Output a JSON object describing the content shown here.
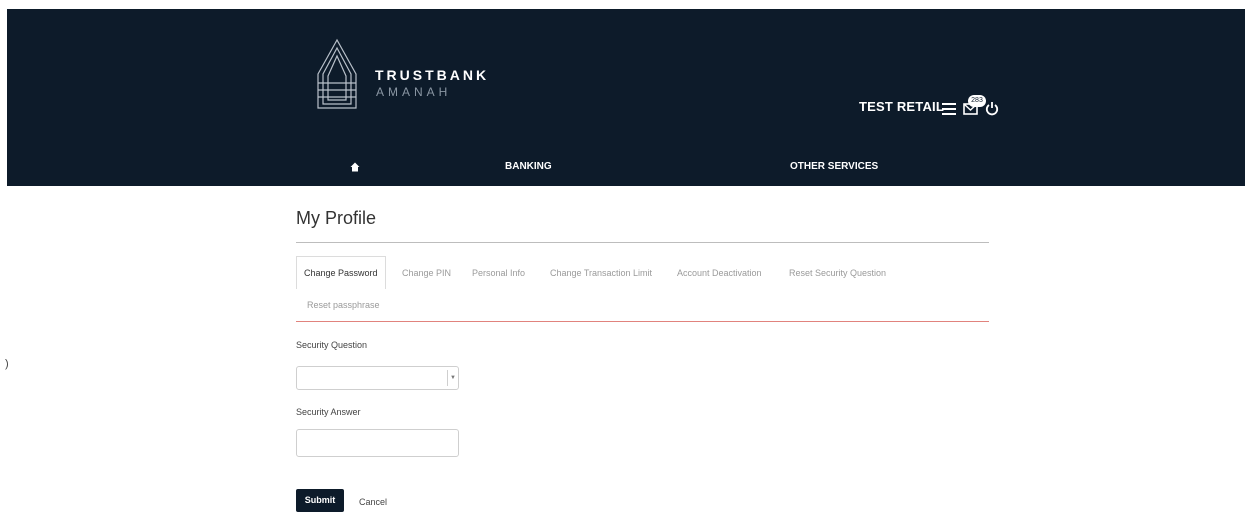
{
  "header": {
    "logo": {
      "name": "TRUSTBANK",
      "sub": "AMANAH"
    },
    "user_name": "TEST RETAIL",
    "mail_badge": "283",
    "icons": [
      "hamburger-menu-icon",
      "mail-icon",
      "power-icon"
    ]
  },
  "nav": {
    "home_icon": "home-icon",
    "banking": "BANKING",
    "other_services": "OTHER SERVICES"
  },
  "page": {
    "title": "My Profile",
    "tabs": [
      "Change Password",
      "Change PIN",
      "Personal Info",
      "Change Transaction Limit",
      "Account Deactivation",
      "Reset Security Question",
      "Reset passphrase"
    ],
    "active_tab": "Change Password"
  },
  "form": {
    "security_question_label": "Security Question",
    "security_question_value": "",
    "security_answer_label": "Security Answer",
    "security_answer_value": "",
    "submit_label": "Submit",
    "cancel_label": "Cancel"
  },
  "edge_mark": ")",
  "colors": {
    "header_bg": "#0d1b2a",
    "tab_underline": "#e1837d",
    "submit_bg": "#0d1b2a"
  }
}
